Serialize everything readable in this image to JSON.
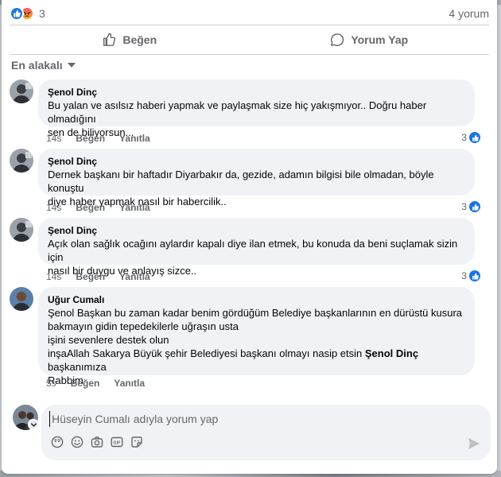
{
  "post_stats": {
    "reaction_count": "3",
    "comment_count": "4 yorum",
    "reactions": [
      "like",
      "angry"
    ]
  },
  "actions": {
    "like_label": "Beğen",
    "comment_label": "Yorum Yap"
  },
  "sort": {
    "label": "En alakalı"
  },
  "comments": [
    {
      "author": "Şenol Dinç",
      "lines": [
        "Bu yalan ve asılsız haberi yapmak ve paylaşmak size hiç yakışmıyor.. Doğru haber olmadığını",
        "sen de biliyorsun..."
      ],
      "time": "14s",
      "like": "Beğen",
      "reply": "Yanıtla",
      "likes": "3"
    },
    {
      "author": "Şenol Dinç",
      "lines": [
        "Dernek başkanı bir haftadır Diyarbakır da, gezide, adamın bilgisi bile olmadan, böyle konuştu",
        "diye haber yapmak nasıl bir habercilik.."
      ],
      "time": "14s",
      "like": "Beğen",
      "reply": "Yanıtla",
      "likes": "3"
    },
    {
      "author": "Şenol Dinç",
      "lines": [
        "Açık olan sağlık ocağını aylardır kapalı diye ilan etmek, bu konuda da beni suçlamak sizin için",
        "nasıl bir duygu ve anlayış sizce.."
      ],
      "time": "14s",
      "like": "Beğen",
      "reply": "Yanıtla",
      "likes": "3"
    },
    {
      "author": "Uğur Cumalı",
      "lines": [
        "Şenol Başkan bu zaman kadar benim gördüğüm Belediye başkanlarının en dürüstü kusura",
        "bakmayın gidin tepedekilerle uğraşın usta",
        "işini sevenlere destek olun"
      ],
      "line4_before": "inşaAllah Sakarya Büyük şehir Belediyesi başkanı olmayı nasip etsin ",
      "line4_mention": "Şenol Dinç",
      "line4_after": " başkanımıza",
      "line5": "Rabbim",
      "time": "5s",
      "like": "Beğen",
      "reply": "Yanıtla"
    }
  ],
  "composer": {
    "placeholder": "Hüseyin Cumalı adıyla yorum yap"
  },
  "colors": {
    "brand_blue": "#1b74e4",
    "bubble_bg": "#f0f2f5",
    "secondary_text": "#65676b"
  }
}
